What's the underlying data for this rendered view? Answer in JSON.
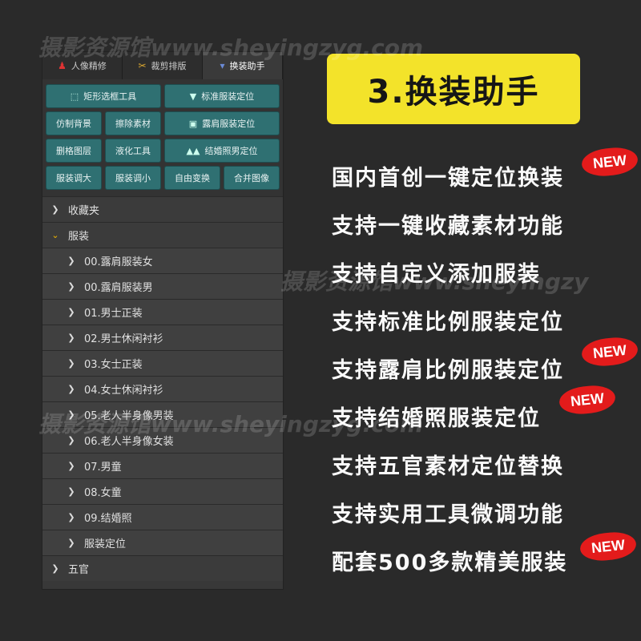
{
  "watermark": "摄影资源馆www.sheyingzyg.com",
  "watermark_mid": "摄影资源馆www.sheyingzy",
  "tabs": [
    {
      "label": "人像精修",
      "icon": "portrait-icon"
    },
    {
      "label": "裁剪排版",
      "icon": "scissors-icon"
    },
    {
      "label": "换装助手",
      "icon": "suit-icon"
    }
  ],
  "buttons": {
    "rect_tool": "矩形选框工具",
    "std_suit": "标准服装定位",
    "fake_bg": "仿制背景",
    "erase": "擦除素材",
    "shoulder": "露肩服装定位",
    "delete_layer": "删格图层",
    "liquify": "液化工具",
    "wedding": "结婚照男定位",
    "bigger": "服装调大",
    "smaller": "服装调小",
    "free_transform": "自由变换",
    "merge": "合并图像"
  },
  "tree": {
    "favorites": "收藏夹",
    "clothing": "服装",
    "items": [
      "00.露肩服装女",
      "00.露肩服装男",
      "01.男士正装",
      "02.男士休闲衬衫",
      "03.女士正装",
      "04.女士休闲衬衫",
      "05.老人半身像男装",
      "06.老人半身像女装",
      "07.男童",
      "08.女童",
      "09.结婚照",
      "服装定位"
    ],
    "features": "五官"
  },
  "title": "3.换装助手",
  "features": [
    "国内首创一键定位换装",
    "支持一键收藏素材功能",
    "支持自定义添加服装",
    "支持标准比例服装定位",
    "支持露肩比例服装定位",
    "支持结婚照服装定位",
    "支持五官素材定位替换",
    "支持实用工具微调功能",
    "配套500多款精美服装"
  ],
  "new_label": "NEW",
  "colors": {
    "accent_yellow": "#f3e32a",
    "new_red": "#e31b1b",
    "button_teal": "#2f7072"
  }
}
